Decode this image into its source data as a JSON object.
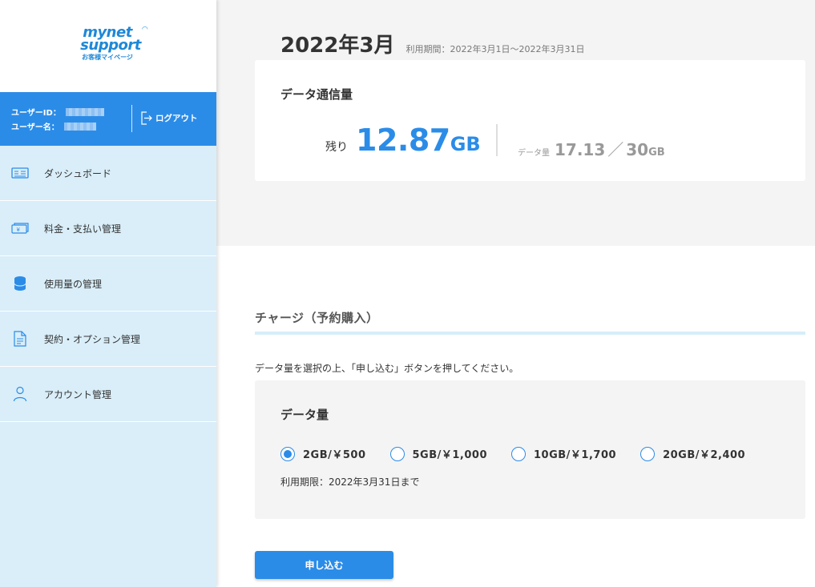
{
  "sidebar": {
    "logo": {
      "line1": "mynet",
      "line2": "support",
      "tagline": "お客様マイページ"
    },
    "user": {
      "id_label": "ユーザーID：",
      "name_label": "ユーザー名："
    },
    "logout_label": "ログアウト",
    "items": [
      {
        "label": "ダッシュボード",
        "icon": "dashboard-icon"
      },
      {
        "label": "料金・支払い管理",
        "icon": "billing-icon"
      },
      {
        "label": "使用量の管理",
        "icon": "database-icon"
      },
      {
        "label": "契約・オプション管理",
        "icon": "document-icon"
      },
      {
        "label": "アカウント管理",
        "icon": "person-icon"
      }
    ]
  },
  "period": {
    "month": "2022年3月",
    "range": "利用期間：2022年3月1日〜2022年3月31日"
  },
  "usage": {
    "title": "データ通信量",
    "remaining_label": "残り",
    "remaining_value": "12.87",
    "remaining_unit": "GB",
    "used_label": "データ量",
    "used_value": "17.13",
    "separator": "／",
    "total_value": "30",
    "total_unit": "GB"
  },
  "charge": {
    "section_title": "チャージ（予約購入）",
    "instruction": "データ量を選択の上、「申し込む」ボタンを押してください。",
    "box_title": "データ量",
    "options": [
      {
        "label": "2GB/￥500",
        "selected": true
      },
      {
        "label": "5GB/￥1,000",
        "selected": false
      },
      {
        "label": "10GB/￥1,700",
        "selected": false
      },
      {
        "label": "20GB/￥2,400",
        "selected": false
      }
    ],
    "limit": "利用期限：2022年3月31日まで",
    "submit_label": "申し込む"
  },
  "colors": {
    "accent": "#2b8ce8",
    "sidebar_bg": "#d9eef9",
    "section_line": "#d6eef9"
  }
}
